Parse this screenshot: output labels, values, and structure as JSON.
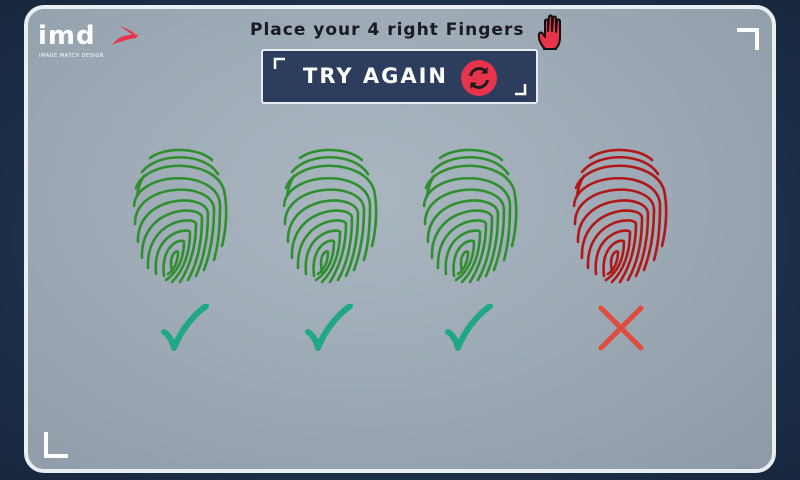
{
  "logo": {
    "text": "imd",
    "subtitle": "IMAGE MATCH DESIGN"
  },
  "header": {
    "instruction": "Place your 4 right Fingers",
    "hand_icon": "hand-icon"
  },
  "action": {
    "try_again_label": "TRY AGAIN",
    "icon": "refresh-icon"
  },
  "colors": {
    "accent": "#e8334d",
    "success": "#1fa886",
    "error": "#e24c3c",
    "fingerprint_ok": "#2f8f2f",
    "fingerprint_bad": "#b01818",
    "button_bg": "#2c3d5e"
  },
  "fingers": [
    {
      "status": "accepted",
      "icon": "check-icon"
    },
    {
      "status": "accepted",
      "icon": "check-icon"
    },
    {
      "status": "accepted",
      "icon": "check-icon"
    },
    {
      "status": "rejected",
      "icon": "cross-icon"
    }
  ]
}
